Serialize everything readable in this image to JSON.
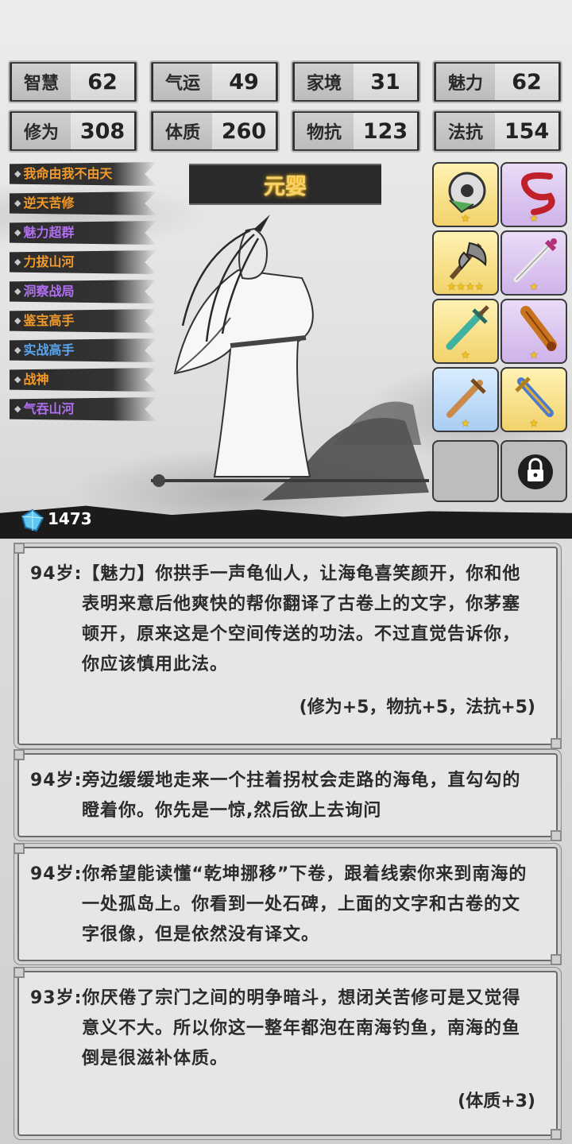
{
  "stats": [
    {
      "label": "智慧",
      "value": "62"
    },
    {
      "label": "气运",
      "value": "49"
    },
    {
      "label": "家境",
      "value": "31"
    },
    {
      "label": "魅力",
      "value": "62"
    },
    {
      "label": "修为",
      "value": "308"
    },
    {
      "label": "体质",
      "value": "260"
    },
    {
      "label": "物抗",
      "value": "123"
    },
    {
      "label": "法抗",
      "value": "154"
    }
  ],
  "talents": [
    {
      "label": "我命由我不由天",
      "color": "#f39a2a"
    },
    {
      "label": "逆天苦修",
      "color": "#f39a2a"
    },
    {
      "label": "魅力超群",
      "color": "#b06ef0"
    },
    {
      "label": "力拔山河",
      "color": "#f39a2a"
    },
    {
      "label": "洞察战局",
      "color": "#b06ef0"
    },
    {
      "label": "鉴宝高手",
      "color": "#f39a2a"
    },
    {
      "label": "实战高手",
      "color": "#5aa6f0"
    },
    {
      "label": "战神",
      "color": "#f39a2a"
    },
    {
      "label": "气吞山河",
      "color": "#b06ef0"
    }
  ],
  "realm": "元婴",
  "equipment": [
    {
      "name": "jade-ring-icon",
      "rarity": "gold",
      "stars": "★"
    },
    {
      "name": "red-ribbon-icon",
      "rarity": "purple",
      "stars": "★"
    },
    {
      "name": "battle-axe-icon",
      "rarity": "gold",
      "stars": "★★★★"
    },
    {
      "name": "sword-icon",
      "rarity": "purple",
      "stars": "★"
    },
    {
      "name": "jade-sword-icon",
      "rarity": "gold",
      "stars": "★"
    },
    {
      "name": "scroll-icon",
      "rarity": "purple",
      "stars": "★"
    },
    {
      "name": "wooden-sword-icon",
      "rarity": "blue",
      "stars": "★"
    },
    {
      "name": "golden-blade-icon",
      "rarity": "gold",
      "stars": "★"
    }
  ],
  "currency": {
    "icon": "crystal-gem-icon",
    "amount": "1473"
  },
  "logs": [
    {
      "text": "94岁:【魅力】你拱手一声龟仙人，让海龟喜笑颜开，你和他表明来意后他爽快的帮你翻译了古卷上的文字，你茅塞顿开，原来这是个空间传送的功法。不过直觉告诉你，你应该慎用此法。",
      "effect": "(修为+5，物抗+5，法抗+5)"
    },
    {
      "text": "94岁:旁边缓缓地走来一个拄着拐杖会走路的海龟，直勾勾的瞪着你。你先是一惊,然后欲上去询问",
      "effect": ""
    },
    {
      "text": "94岁:你希望能读懂“乾坤挪移”下卷，跟着线索你来到南海的一处孤岛上。你看到一处石碑，上面的文字和古卷的文字很像，但是依然没有译文。",
      "effect": ""
    },
    {
      "text": "93岁:你厌倦了宗门之间的明争暗斗，想闭关苦修可是又觉得意义不大。所以你这一整年都泡在南海钓鱼，南海的鱼倒是很滋补体质。",
      "effect": "(体质+3)"
    }
  ]
}
